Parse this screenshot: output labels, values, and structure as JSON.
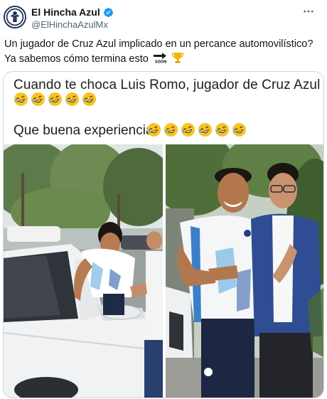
{
  "author": {
    "display_name": "El Hincha Azul",
    "handle": "@ElHinchaAzulMx",
    "verified": true
  },
  "tweet": {
    "text": "Un jugador de Cruz Azul implicado en un percance automovilístico? Ya sabemos cómo termina esto",
    "trailing_emoji": [
      "soon-arrow-icon",
      "trophy-icon"
    ]
  },
  "media": {
    "caption_line1": "Cuando te choca Luis Romo, jugador de Cruz Azul",
    "caption_line1_emoji": [
      "rofl",
      "rofl",
      "rofl",
      "rofl",
      "rofl"
    ],
    "caption_line2": "Que buena experiencia",
    "caption_line2_emoji": [
      "rofl",
      "rofl",
      "rofl",
      "rofl",
      "rofl",
      "rofl"
    ],
    "photos": [
      "player-at-white-car-photo",
      "player-posing-with-fan-photo"
    ]
  },
  "colors": {
    "verified_blue": "#1d9bf0",
    "handle_gray": "#536471",
    "border": "#cfd9de"
  }
}
